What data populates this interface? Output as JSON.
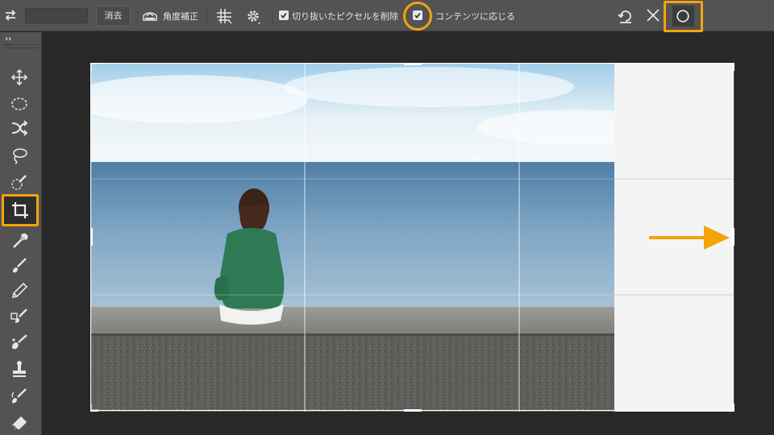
{
  "options_bar": {
    "swap_icon": "swap-arrows-icon",
    "ratio_value": "",
    "clear_label": "消去",
    "straighten_label": "角度補正",
    "grid_icon": "crop-grid-icon",
    "settings_icon": "gear-icon",
    "delete_cropped_pixels": {
      "label": "切り抜いたピクセルを削除",
      "checked": true
    },
    "content_aware": {
      "label": "コンテンツに応じる",
      "checked": true
    },
    "reset_icon": "reset-icon",
    "cancel_icon": "close-icon",
    "commit_icon": "commit-circle-icon"
  },
  "toolbar": {
    "collapse_label": "››",
    "tools": [
      {
        "name": "move-tool",
        "icon": "move-icon"
      },
      {
        "name": "marquee-tool",
        "icon": "elliptical-marquee-icon"
      },
      {
        "name": "object-selection-tool",
        "icon": "shuffle-icon"
      },
      {
        "name": "lasso-tool",
        "icon": "lasso-icon"
      },
      {
        "name": "quick-selection-tool",
        "icon": "quick-selection-icon"
      },
      {
        "name": "crop-tool",
        "icon": "crop-icon",
        "active": true
      },
      {
        "name": "eyedropper-tool",
        "icon": "eyedropper-icon"
      },
      {
        "name": "brush-tool",
        "icon": "brush-icon"
      },
      {
        "name": "pencil-tool",
        "icon": "pencil-icon"
      },
      {
        "name": "clone-brush-tool",
        "icon": "clone-brush-icon"
      },
      {
        "name": "healing-brush-tool",
        "icon": "healing-brush-icon"
      },
      {
        "name": "stamp-tool",
        "icon": "stamp-icon"
      },
      {
        "name": "history-brush-tool",
        "icon": "history-brush-icon"
      },
      {
        "name": "eraser-tool",
        "icon": "eraser-icon"
      }
    ]
  },
  "colors": {
    "accent": "#f5a30a",
    "panel": "#535353",
    "canvas": "#282828",
    "extension": "#f4f4f4"
  }
}
